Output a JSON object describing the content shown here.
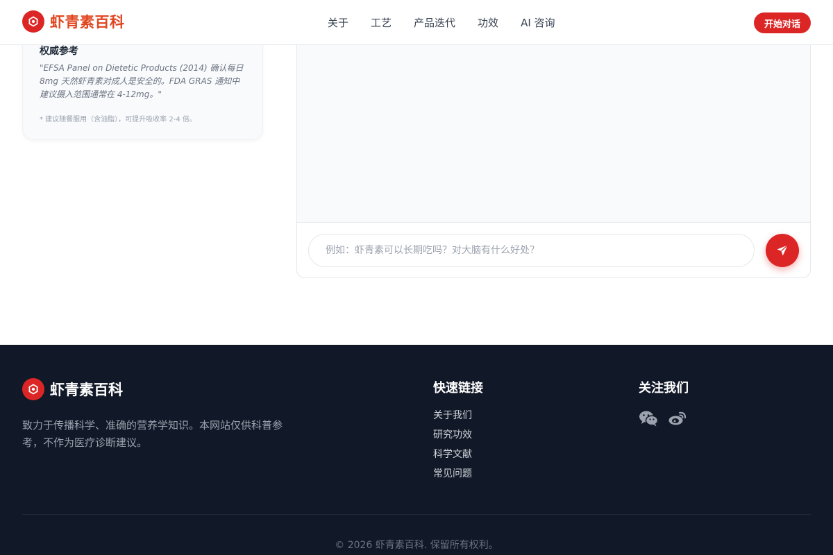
{
  "header": {
    "brand_name": "虾青素百科",
    "logo_icon": "hexagon-molecule-icon",
    "nav": [
      "关于",
      "工艺",
      "产品迭代",
      "功效",
      "AI 咨询"
    ],
    "cta_label": "开始对话"
  },
  "reference_card": {
    "title": "权威参考",
    "quote": "\"EFSA Panel on Dietetic Products (2014) 确认每日 8mg 天然虾青素对成人是安全的。FDA GRAS 通知中建议摄入范围通常在 4-12mg。\"",
    "note": "* 建议随餐服用（含油脂），可提升吸收率 2-4 倍。"
  },
  "chat": {
    "input_placeholder": "例如：虾青素可以长期吃吗？对大脑有什么好处？",
    "send_icon": "paper-plane-icon"
  },
  "footer": {
    "brand_name": "虾青素百科",
    "description": "致力于传播科学、准确的营养学知识。本网站仅供科普参考，不作为医疗诊断建议。",
    "quick_links_title": "快速链接",
    "quick_links": [
      "关于我们",
      "研究功效",
      "科学文献",
      "常见问题"
    ],
    "follow_title": "关注我们",
    "social_icons": [
      "wechat-icon",
      "weibo-icon"
    ],
    "copyright": "© 2026 虾青素百科. 保留所有权利。"
  },
  "colors": {
    "primary": "#dc2626",
    "brand_text": "#e1451f",
    "footer_bg": "#111827"
  }
}
